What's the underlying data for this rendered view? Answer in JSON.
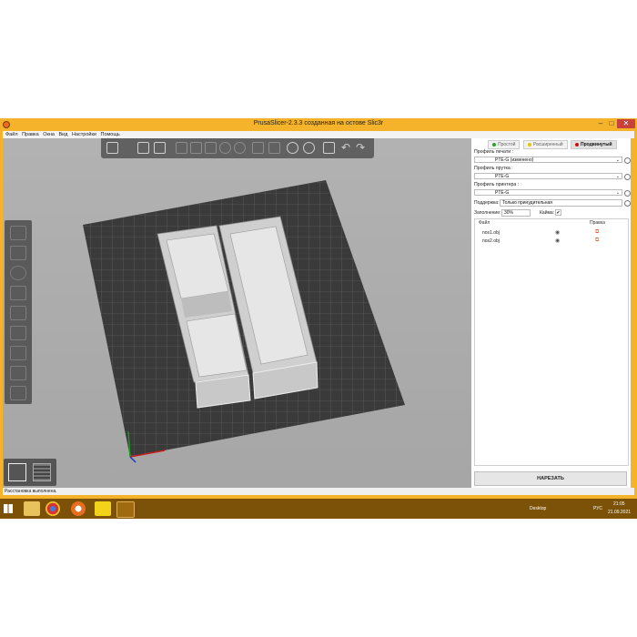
{
  "window": {
    "title": "PrusaSlicer-2.3.3 созданная на остове Slic3r"
  },
  "menu": [
    "Файл",
    "Правка",
    "Окна",
    "Вид",
    "Настройки",
    "Помощь"
  ],
  "modes": {
    "simple": "Простой",
    "advanced": "Расширенный",
    "expert": "Продвинутый"
  },
  "colors": {
    "accent": "#f4b32a",
    "taskbar": "#7b5208",
    "simple": "#2aa52a",
    "advanced": "#e5c700",
    "expert": "#cc1111",
    "bed": "#3a3a3a",
    "grid": "#6c6c6c",
    "model": "#d0d0d0"
  },
  "print_profile": {
    "label": "Профиль печати :",
    "value": "PTE-G (изменено)"
  },
  "filament_profile": {
    "label": "Профиль прутка :",
    "value": "PTE-G"
  },
  "printer_profile": {
    "label": "Профиль принтера :",
    "value": "PTE-G"
  },
  "supports": {
    "label": "Поддержка:",
    "value": "Только принудительная"
  },
  "infill": {
    "label": "Заполнение:",
    "value": "30%"
  },
  "brim": {
    "label": "Кайма:",
    "checked": true,
    "mark": "✔"
  },
  "object_list": {
    "headers": {
      "name": "Файл",
      "edit": "Правка"
    },
    "rows": [
      {
        "name": "nos1.obj"
      },
      {
        "name": "nos2.obj"
      }
    ]
  },
  "slice_button": "НАРЕЗАТЬ",
  "status": "Расстановка выполнена.",
  "taskbar": {
    "desktop": "Desktop",
    "lang": "РУС",
    "time": "21:05",
    "date": "21.09.2021"
  },
  "icons": [
    "add-object-icon",
    "delete-icon",
    "delete-all-icon",
    "arrange-icon",
    "copy-icon",
    "paste-icon",
    "add-instance-icon",
    "remove-instance-icon",
    "split-objects-icon",
    "split-parts-icon",
    "layer-editing-icon",
    "search-icon",
    "variable-layer-icon",
    "undo-icon",
    "redo-icon"
  ]
}
